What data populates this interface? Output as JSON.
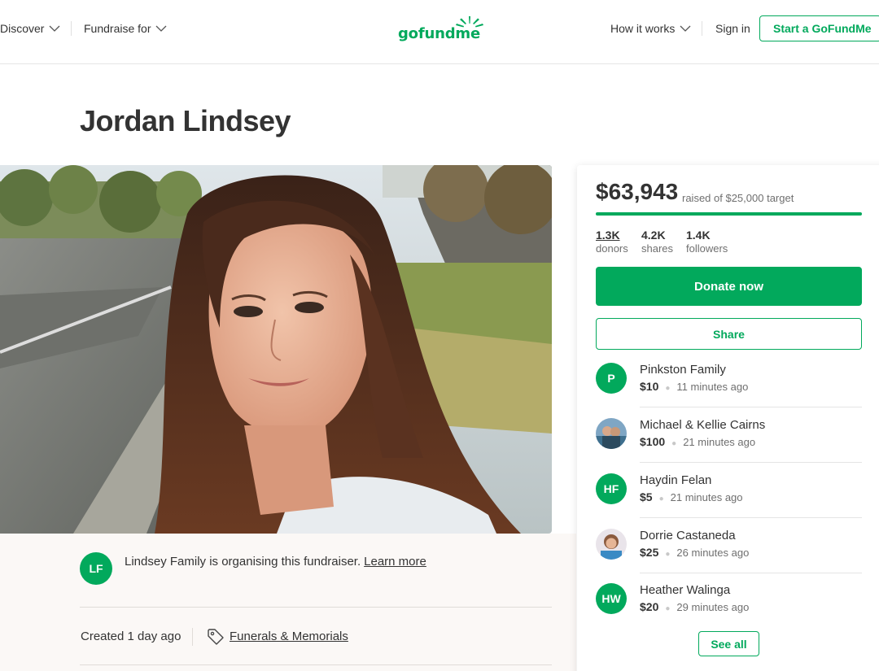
{
  "nav": {
    "discover": "Discover",
    "fundraise_for": "Fundraise for",
    "how_it_works": "How it works",
    "sign_in": "Sign in",
    "start": "Start a GoFundMe",
    "logo": "gofundme"
  },
  "campaign": {
    "title": "Jordan Lindsey",
    "organizer_initials": "LF",
    "organizer_text": "Lindsey Family is organising this fundraiser.",
    "learn_more": "Learn more",
    "created": "Created 1 day ago",
    "category": "Funerals & Memorials"
  },
  "progress": {
    "raised": "$63,943",
    "target_text": "raised of $25,000 target",
    "fraction": 1.0
  },
  "stats": [
    {
      "value": "1.3K",
      "label": "donors"
    },
    {
      "value": "4.2K",
      "label": "shares"
    },
    {
      "value": "1.4K",
      "label": "followers"
    }
  ],
  "buttons": {
    "donate": "Donate now",
    "share": "Share",
    "see_all": "See all"
  },
  "donations": [
    {
      "initials": "P",
      "name": "Pinkston Family",
      "amount": "$10",
      "time": "11 minutes ago",
      "avatar": "initials"
    },
    {
      "initials": "",
      "name": "Michael & Kellie Cairns",
      "amount": "$100",
      "time": "21 minutes ago",
      "avatar": "photo"
    },
    {
      "initials": "HF",
      "name": "Haydin Felan",
      "amount": "$5",
      "time": "21 minutes ago",
      "avatar": "initials"
    },
    {
      "initials": "",
      "name": "Dorrie Castaneda",
      "amount": "$25",
      "time": "26 minutes ago",
      "avatar": "photo"
    },
    {
      "initials": "HW",
      "name": "Heather Walinga",
      "amount": "$20",
      "time": "29 minutes ago",
      "avatar": "initials"
    }
  ],
  "colors": {
    "brand": "#02a95c",
    "text": "#333333",
    "muted": "#6f6f6f",
    "cream": "#fbf8f6"
  }
}
